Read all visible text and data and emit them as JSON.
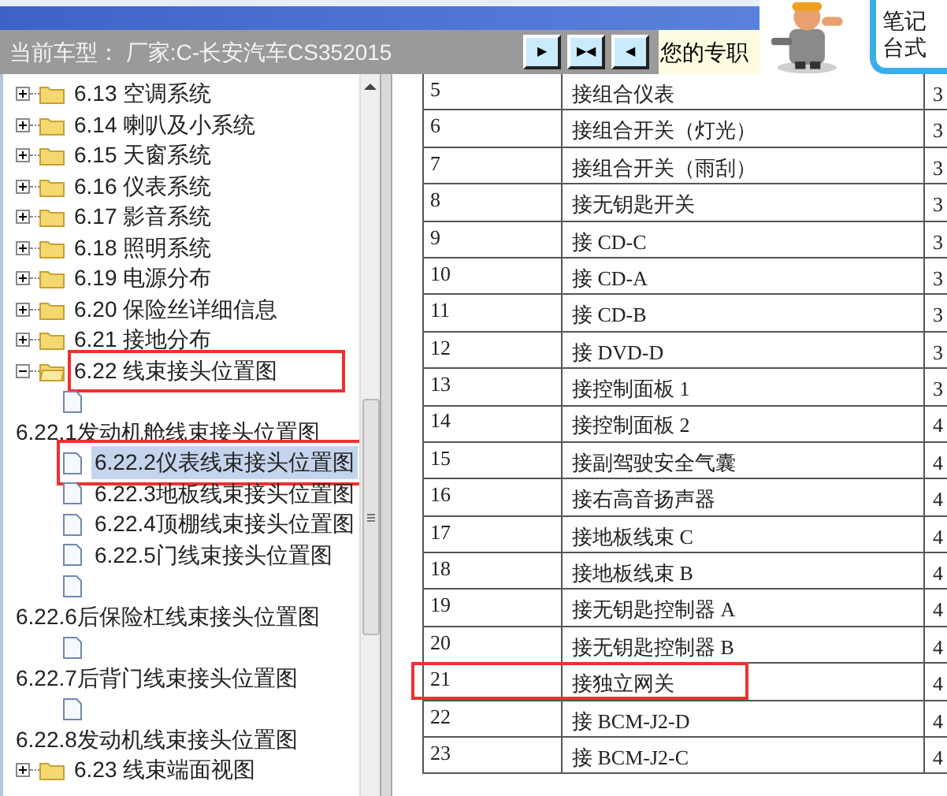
{
  "header": {
    "model_label": "当前车型： 厂家:C-长安汽车CS352015",
    "buttons": [
      {
        "glyph": "▶"
      },
      {
        "glyph": "▶◀"
      },
      {
        "glyph": "◀"
      }
    ],
    "notice": "您的专职",
    "ad": {
      "lines": [
        "笔记",
        "台式"
      ]
    }
  },
  "tree": [
    {
      "kind": "folder",
      "label": "6.13 空调系统",
      "expanded": false,
      "highlighted": false
    },
    {
      "kind": "folder",
      "label": "6.14 喇叭及小系统",
      "expanded": false,
      "highlighted": false
    },
    {
      "kind": "folder",
      "label": "6.15 天窗系统",
      "expanded": false,
      "highlighted": false
    },
    {
      "kind": "folder",
      "label": "6.16 仪表系统",
      "expanded": false,
      "highlighted": false
    },
    {
      "kind": "folder",
      "label": "6.17 影音系统",
      "expanded": false,
      "highlighted": false
    },
    {
      "kind": "folder",
      "label": "6.18 照明系统",
      "expanded": false,
      "highlighted": false
    },
    {
      "kind": "folder",
      "label": "6.19 电源分布",
      "expanded": false,
      "highlighted": false
    },
    {
      "kind": "folder",
      "label": "6.20 保险丝详细信息",
      "expanded": false,
      "highlighted": false
    },
    {
      "kind": "folder",
      "label": "6.21 接地分布",
      "expanded": false,
      "highlighted": false
    },
    {
      "kind": "folder",
      "label": "6.22 线束接头位置图",
      "expanded": true,
      "highlighted": true,
      "children": [
        {
          "kind": "page",
          "selected": false
        },
        {
          "kind": "heading",
          "label": "6.22.1发动机舱线束接头位置图",
          "children": [
            {
              "kind": "page",
              "label": "6.22.2仪表线束接头位置图",
              "selected": true,
              "highlighted": true
            },
            {
              "kind": "page",
              "label": "6.22.3地板线束接头位置图",
              "selected": false,
              "highlighted": false
            },
            {
              "kind": "page",
              "label": "6.22.4顶棚线束接头位置图",
              "selected": false,
              "highlighted": false
            },
            {
              "kind": "page",
              "label": "6.22.5门线束接头位置图",
              "selected": false,
              "highlighted": false
            },
            {
              "kind": "page",
              "selected": false
            }
          ]
        },
        {
          "kind": "heading",
          "label": "6.22.6后保险杠线束接头位置图",
          "children": [
            {
              "kind": "page",
              "selected": false
            }
          ]
        },
        {
          "kind": "heading",
          "label": "6.22.7后背门线束接头位置图",
          "children": [
            {
              "kind": "page",
              "selected": false
            }
          ]
        },
        {
          "kind": "heading",
          "label": "6.22.8发动机线束接头位置图"
        }
      ]
    },
    {
      "kind": "folder",
      "label": "6.23 线束端面视图",
      "expanded": false,
      "highlighted": false
    }
  ],
  "table": {
    "rows": [
      {
        "cells": [
          "5",
          "接组合仪表",
          "3"
        ],
        "highlighted": false
      },
      {
        "cells": [
          "6",
          "接组合开关（灯光）",
          "3"
        ],
        "highlighted": false
      },
      {
        "cells": [
          "7",
          "接组合开关（雨刮）",
          "3"
        ],
        "highlighted": false
      },
      {
        "cells": [
          "8",
          "接无钥匙开关",
          "3"
        ],
        "highlighted": false
      },
      {
        "cells": [
          "9",
          "接 CD-C",
          "3"
        ],
        "highlighted": false
      },
      {
        "cells": [
          "10",
          "接 CD-A",
          "3"
        ],
        "highlighted": false
      },
      {
        "cells": [
          "11",
          "接 CD-B",
          "3"
        ],
        "highlighted": false
      },
      {
        "cells": [
          "12",
          "接 DVD-D",
          "3"
        ],
        "highlighted": false
      },
      {
        "cells": [
          "13",
          "接控制面板 1",
          "3"
        ],
        "highlighted": false
      },
      {
        "cells": [
          "14",
          "接控制面板 2",
          "4"
        ],
        "highlighted": false
      },
      {
        "cells": [
          "15",
          "接副驾驶安全气囊",
          "4"
        ],
        "highlighted": false
      },
      {
        "cells": [
          "16",
          "接右高音扬声器",
          "4"
        ],
        "highlighted": false
      },
      {
        "cells": [
          "17",
          "接地板线束 C",
          "4"
        ],
        "highlighted": false
      },
      {
        "cells": [
          "18",
          "接地板线束 B",
          "4"
        ],
        "highlighted": false
      },
      {
        "cells": [
          "19",
          "接无钥匙控制器 A",
          "4"
        ],
        "highlighted": false
      },
      {
        "cells": [
          "20",
          "接无钥匙控制器 B",
          "4"
        ],
        "highlighted": false
      },
      {
        "cells": [
          "21",
          "接独立网关",
          "4"
        ],
        "highlighted": true
      },
      {
        "cells": [
          "22",
          "接 BCM-J2-D",
          "4"
        ],
        "highlighted": false
      },
      {
        "cells": [
          "23",
          "接 BCM-J2-C",
          "4"
        ],
        "highlighted": false
      }
    ]
  }
}
